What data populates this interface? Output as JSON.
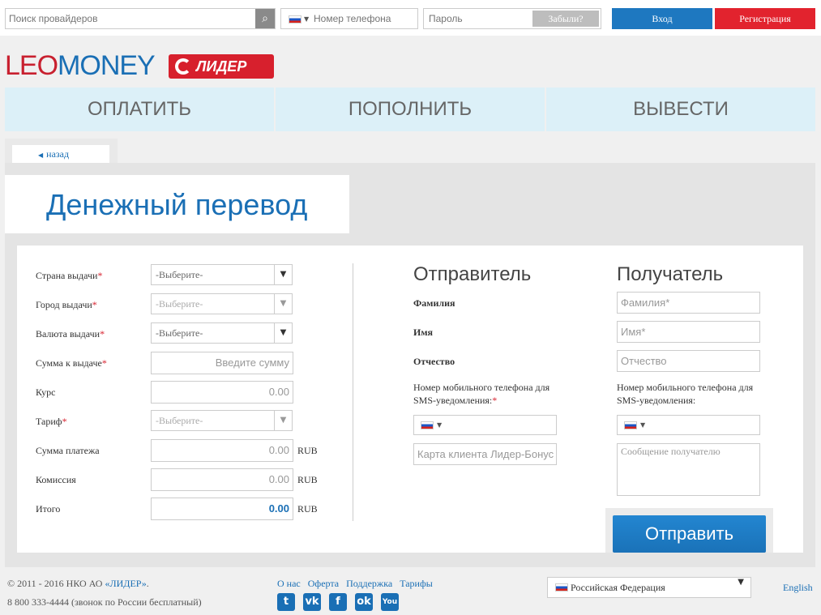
{
  "topbar": {
    "search_placeholder": "Поиск провайдеров",
    "phone_placeholder": "Номер телефона",
    "password_placeholder": "Пароль",
    "forgot_label": "Забыли?",
    "login_label": "Вход",
    "register_label": "Регистрация"
  },
  "logo": {
    "part1": "LEO",
    "part2": "MONEY",
    "badge": "ЛИДЕР"
  },
  "nav": {
    "pay": "ОПЛАТИТЬ",
    "topup": "ПОПОЛНИТЬ",
    "withdraw": "ВЫВЕСТИ"
  },
  "back_label": "назад",
  "page_title": "Денежный перевод",
  "form": {
    "country_label": "Страна выдачи",
    "country_value": "-Выберите-",
    "city_label": "Город выдачи",
    "city_value": "-Выберите-",
    "currency_label": "Валюта выдачи",
    "currency_value": "-Выберите-",
    "amount_label": "Сумма к выдаче",
    "amount_placeholder": "Введите сумму",
    "rate_label": "Курс",
    "rate_value": "0.00",
    "tariff_label": "Тариф",
    "tariff_value": "-Выберите-",
    "payment_label": "Сумма платежа",
    "payment_value": "0.00",
    "commission_label": "Комиссия",
    "commission_value": "0.00",
    "total_label": "Итого",
    "total_value": "0.00",
    "currency_code": "RUB",
    "required_mark": "*"
  },
  "sender": {
    "heading": "Отправитель",
    "last_name": "Фамилия",
    "first_name": "Имя",
    "patronymic": "Отчество",
    "sms_label_1": "Номер мобильного телефона для",
    "sms_label_2": "SMS-уведомления:",
    "card_placeholder": "Карта клиента Лидер-Бонус"
  },
  "recipient": {
    "heading": "Получатель",
    "last_name_placeholder": "Фамилия*",
    "first_name_placeholder": "Имя*",
    "patronymic_placeholder": "Отчество",
    "sms_label_1": "Номер мобильного телефона для",
    "sms_label_2": "SMS-уведомления:",
    "message_placeholder": "Сообщение получателю"
  },
  "send_label": "Отправить",
  "footer": {
    "copyright_prefix": "© 2011 - 2016 НКО АО ",
    "company_link": "«ЛИДЕР»",
    "copyright_suffix": ".",
    "phone_text": "8 800 333-4444 (звонок по России бесплатный)",
    "links": [
      "О нас",
      "Оферта",
      "Поддержка",
      "Тарифы"
    ],
    "social": [
      "twitter",
      "vkontakte",
      "facebook",
      "odnoklassniki",
      "youtube"
    ],
    "country": "Российская Федерация",
    "language": "English"
  }
}
